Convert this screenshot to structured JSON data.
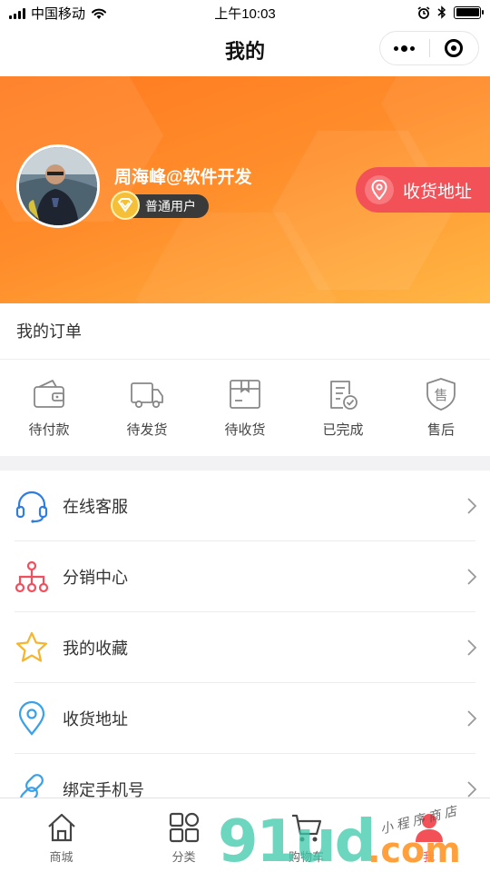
{
  "status_bar": {
    "carrier": "中国移动",
    "time": "上午10:03",
    "battery_level": 1.0
  },
  "nav": {
    "title": "我的"
  },
  "profile": {
    "username": "周海峰@软件开发",
    "level": "普通用户",
    "address_button": "收货地址"
  },
  "orders": {
    "title": "我的订单",
    "items": [
      {
        "label": "待付款",
        "icon": "wallet-icon"
      },
      {
        "label": "待发货",
        "icon": "truck-icon"
      },
      {
        "label": "待收货",
        "icon": "package-icon"
      },
      {
        "label": "已完成",
        "icon": "completed-doc-icon"
      },
      {
        "label": "售后",
        "icon": "after-sale-shield-icon"
      }
    ]
  },
  "menu": {
    "items": [
      {
        "label": "在线客服",
        "icon": "headset-icon",
        "color": "#2f7de1"
      },
      {
        "label": "分销中心",
        "icon": "network-icon",
        "color": "#f04f5e"
      },
      {
        "label": "我的收藏",
        "icon": "star-icon",
        "color": "#f5b52e"
      },
      {
        "label": "收货地址",
        "icon": "location-pin-icon",
        "color": "#3aa0e8"
      },
      {
        "label": "绑定手机号",
        "icon": "link-icon",
        "color": "#3aa0e8"
      }
    ]
  },
  "tabbar": {
    "items": [
      {
        "label": "商城",
        "icon": "home-icon"
      },
      {
        "label": "分类",
        "icon": "category-grid-icon"
      },
      {
        "label": "购物车",
        "icon": "cart-icon"
      },
      {
        "label": "我",
        "icon": "profile-icon",
        "active": true
      }
    ]
  },
  "watermark": {
    "text": "91ud",
    "domain": ".com",
    "script": "小程序商店"
  },
  "colors": {
    "banner_start": "#ff7a1f",
    "banner_end": "#ffb744",
    "address_pill": "#f25158",
    "tab_active": "#f25158"
  }
}
